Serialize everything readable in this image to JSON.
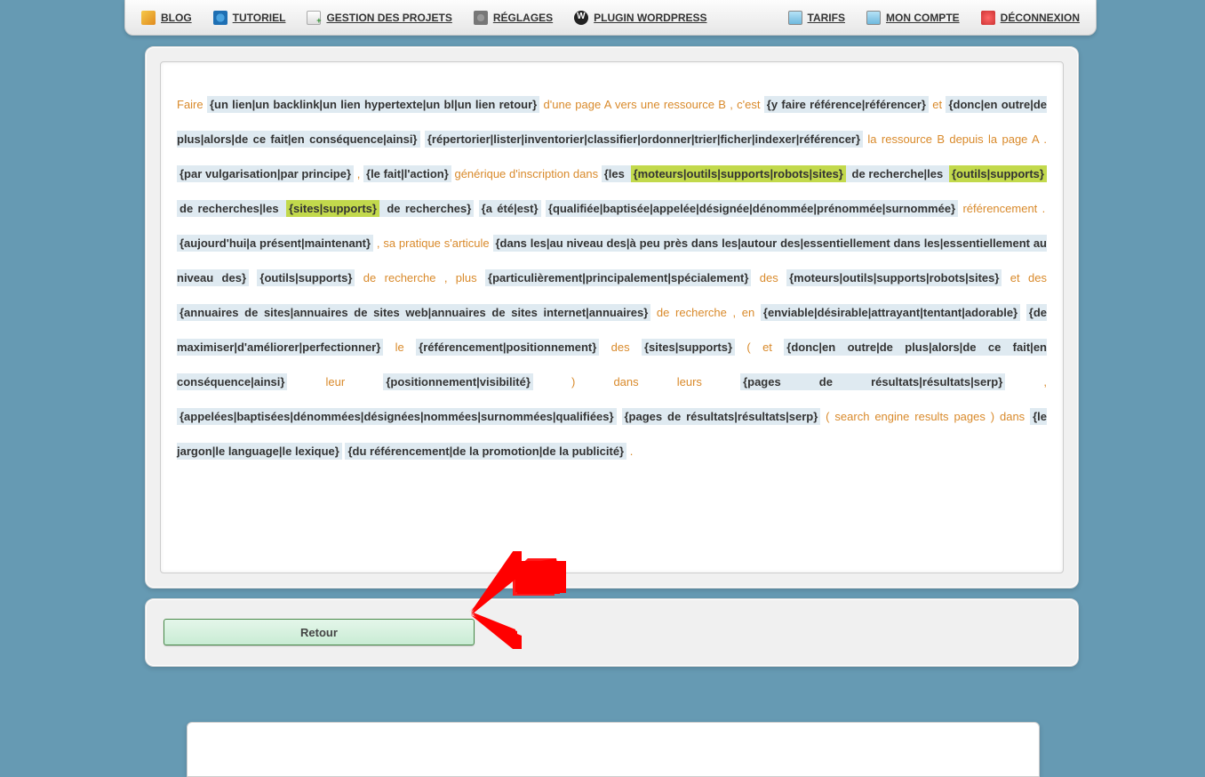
{
  "nav": {
    "left": [
      {
        "label": "BLOG",
        "icon": "ic-blog",
        "name": "nav-blog"
      },
      {
        "label": "TUTORIEL",
        "icon": "ic-tut",
        "name": "nav-tutoriel"
      },
      {
        "label": "GESTION DES PROJETS",
        "icon": "ic-proj",
        "name": "nav-gestion-projets"
      },
      {
        "label": "RÉGLAGES",
        "icon": "ic-set",
        "name": "nav-reglages"
      },
      {
        "label": "PLUGIN WORDPRESS",
        "icon": "ic-wp",
        "name": "nav-plugin-wordpress"
      }
    ],
    "right": [
      {
        "label": "TARIFS",
        "icon": "ic-tar",
        "name": "nav-tarifs"
      },
      {
        "label": "MON COMPTE",
        "icon": "ic-acc",
        "name": "nav-mon-compte"
      },
      {
        "label": "DÉCONNEXION",
        "icon": "ic-out",
        "name": "nav-deconnexion"
      }
    ]
  },
  "segments": [
    {
      "t": "Faire ",
      "c": "txt"
    },
    {
      "t": "{un lien|un backlink|un lien hypertexte|un bl|un lien retour}",
      "c": "spin"
    },
    {
      "t": " d'une page A vers une ressource B , c'est ",
      "c": "txt"
    },
    {
      "t": "{y faire référence|référencer}",
      "c": "spin"
    },
    {
      "t": " et ",
      "c": "txt"
    },
    {
      "t": "{donc|en outre|de plus|alors|de ce fait|en conséquence|ainsi}",
      "c": "spin"
    },
    {
      "t": " ",
      "c": "txt"
    },
    {
      "t": "{répertorier|lister|inventorier|classifier|ordonner|trier|ficher|indexer|référencer}",
      "c": "spin"
    },
    {
      "t": " la ressource B depuis la page A . ",
      "c": "txt"
    },
    {
      "t": "{par vulgarisation|par principe}",
      "c": "spin"
    },
    {
      "t": " , ",
      "c": "txt"
    },
    {
      "t": "{le fait|l'action}",
      "c": "spin"
    },
    {
      "t": " générique d'inscription dans ",
      "c": "txt"
    },
    {
      "t": "{les ",
      "c": "spin"
    },
    {
      "t": "{moteurs|outils|supports|robots|sites}",
      "c": "hl"
    },
    {
      "t": " de recherche|les ",
      "c": "spin"
    },
    {
      "t": "{outils|supports}",
      "c": "hl"
    },
    {
      "t": " de recherches|les ",
      "c": "spin"
    },
    {
      "t": "{sites|supports}",
      "c": "hl"
    },
    {
      "t": " de recherches}",
      "c": "spin"
    },
    {
      "t": " ",
      "c": "txt"
    },
    {
      "t": "{a été|est}",
      "c": "spin"
    },
    {
      "t": " ",
      "c": "txt"
    },
    {
      "t": "{qualifiée|baptisée|appelée|désignée|dénommée|prénommée|surnommée}",
      "c": "spin"
    },
    {
      "t": " référencement . ",
      "c": "txt"
    },
    {
      "t": "{aujourd'hui|a présent|maintenant}",
      "c": "spin"
    },
    {
      "t": " , sa pratique s'articule ",
      "c": "txt"
    },
    {
      "t": "{dans les|au niveau des|à peu près dans les|autour des|essentiellement dans les|essentiellement au niveau des}",
      "c": "spin"
    },
    {
      "t": " ",
      "c": "txt"
    },
    {
      "t": "{outils|supports}",
      "c": "spin"
    },
    {
      "t": " de recherche , plus ",
      "c": "txt"
    },
    {
      "t": "{particulièrement|principalement|spécialement}",
      "c": "spin"
    },
    {
      "t": " des ",
      "c": "txt"
    },
    {
      "t": "{moteurs|outils|supports|robots|sites}",
      "c": "spin"
    },
    {
      "t": " et des ",
      "c": "txt"
    },
    {
      "t": "{annuaires de sites|annuaires de sites web|annuaires de sites internet|annuaires}",
      "c": "spin"
    },
    {
      "t": " de recherche , en ",
      "c": "txt"
    },
    {
      "t": "{enviable|désirable|attrayant|tentant|adorable}",
      "c": "spin"
    },
    {
      "t": " ",
      "c": "txt"
    },
    {
      "t": "{de maximiser|d'améliorer|perfectionner}",
      "c": "spin"
    },
    {
      "t": " le ",
      "c": "txt"
    },
    {
      "t": "{référencement|positionnement}",
      "c": "spin"
    },
    {
      "t": " des ",
      "c": "txt"
    },
    {
      "t": "{sites|supports}",
      "c": "spin"
    },
    {
      "t": " ( et ",
      "c": "txt"
    },
    {
      "t": "{donc|en outre|de plus|alors|de ce fait|en conséquence|ainsi}",
      "c": "spin"
    },
    {
      "t": " leur ",
      "c": "txt"
    },
    {
      "t": "{positionnement|visibilité}",
      "c": "spin"
    },
    {
      "t": " ) dans leurs ",
      "c": "txt"
    },
    {
      "t": "{pages de résultats|résultats|serp}",
      "c": "spin"
    },
    {
      "t": " , ",
      "c": "txt"
    },
    {
      "t": "{appelées|baptisées|dénommées|désignées|nommées|surnommées|qualifiées}",
      "c": "spin"
    },
    {
      "t": " ",
      "c": "txt"
    },
    {
      "t": "{pages de résultats|résultats|serp}",
      "c": "spin"
    },
    {
      "t": " ( search engine results pages ) dans ",
      "c": "txt"
    },
    {
      "t": "{le jargon|le language|le lexique}",
      "c": "spin"
    },
    {
      "t": " ",
      "c": "txt"
    },
    {
      "t": "{du référencement|de la promotion|de la publicité}",
      "c": "spin"
    },
    {
      "t": " .",
      "c": "txt"
    }
  ],
  "buttons": {
    "retour": "Retour"
  }
}
